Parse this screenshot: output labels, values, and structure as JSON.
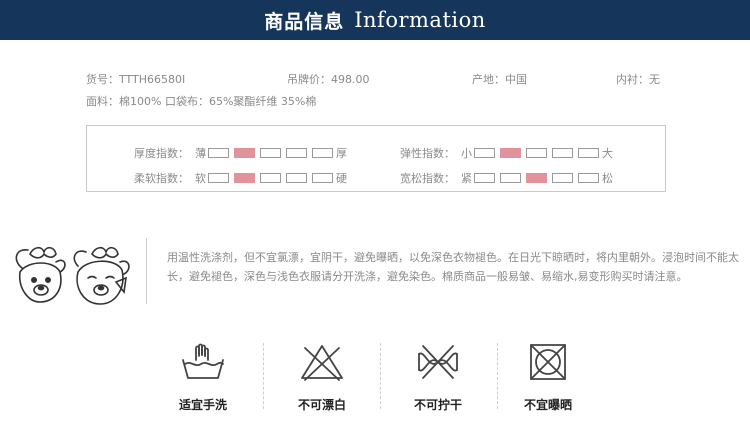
{
  "header": {
    "title_cn": "商品信息",
    "title_en": "Information"
  },
  "info": {
    "item_no": "货号：TTTH66580I",
    "tag_price": "吊牌价：498.00",
    "origin": "产地：中国",
    "lining": "内衬：无",
    "fabric": "面料：棉100% 口袋布：65%聚酯纤维 35%棉"
  },
  "specs": [
    {
      "label": "厚度指数：",
      "low": "薄",
      "high": "厚",
      "level": 2,
      "steps": 5
    },
    {
      "label": "弹性指数：",
      "low": "小",
      "high": "大",
      "level": 2,
      "steps": 5
    },
    {
      "label": "柔软指数：",
      "low": "软",
      "high": "硬",
      "level": 2,
      "steps": 5
    },
    {
      "label": "宽松指数：",
      "low": "紧",
      "high": "松",
      "level": 3,
      "steps": 5
    }
  ],
  "care_text": "用温性洗涤剂，但不宜氯漂，宜阴干，避免曝晒，以免深色衣物褪色。在日光下晾晒时，将内里朝外。浸泡时间不能太长，避免褪色，深色与浅色衣服请分开洗涤，避免染色。棉质商品一般易皱、易缩水,易变形购买时请注意。",
  "care_icons": [
    {
      "label": "适宜手洗",
      "icon": "hand-wash-icon"
    },
    {
      "label": "不可漂白",
      "icon": "no-bleach-icon"
    },
    {
      "label": "不可拧干",
      "icon": "no-wring-icon"
    },
    {
      "label": "不宜曝晒",
      "icon": "no-tumble-dry-icon"
    }
  ],
  "colors": {
    "header_bg": "#15365a",
    "level_fill": "#e2929b",
    "text": "#8a8a8a"
  }
}
